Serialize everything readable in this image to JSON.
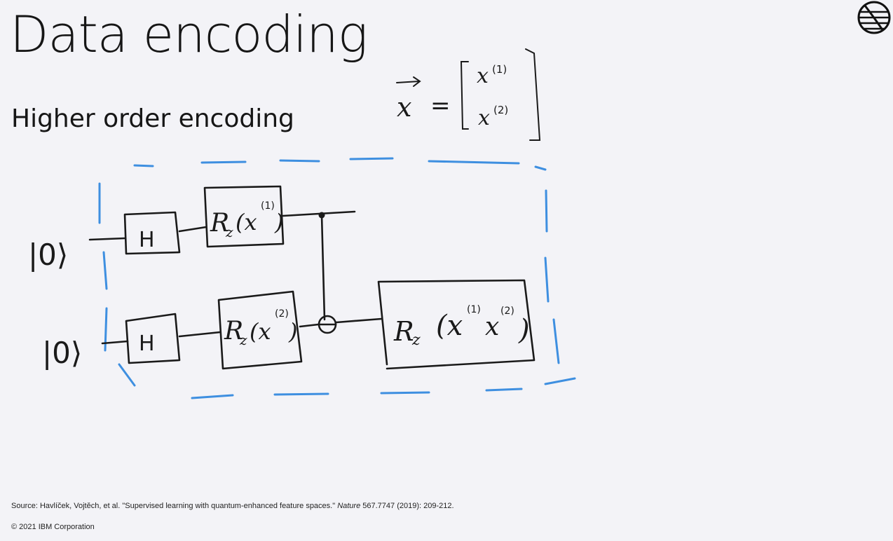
{
  "slide": {
    "title": "Data encoding",
    "subtitle": "Higher order encoding"
  },
  "vector": {
    "symbol": "x",
    "equals": "=",
    "entries": [
      "x",
      "x"
    ],
    "superscripts": [
      "(1)",
      "(2)"
    ]
  },
  "circuit": {
    "qubits": [
      {
        "state": "|0⟩",
        "hadamard": "H",
        "rz_gate": "R",
        "rz_sub": "z",
        "rz_arg": "(x",
        "rz_sup": "(1)",
        "rz_close": ")"
      },
      {
        "state": "|0⟩",
        "hadamard": "H",
        "rz_gate": "R",
        "rz_sub": "z",
        "rz_arg": "(x",
        "rz_sup": "(2)",
        "rz_close": ")"
      }
    ],
    "entangling_gate": {
      "r": "R",
      "sub": "z",
      "open": "(x",
      "sup1": "(1)",
      "x2": "x",
      "sup2": "(2)",
      "close": ")"
    }
  },
  "footer": {
    "source_prefix": "Source: Havlíček, Vojtěch, et al. \"Supervised learning with quantum-enhanced feature spaces.\" ",
    "source_journal": "Nature",
    "source_suffix": " 567.7747 (2019): 209-212.",
    "copyright": "© 2021 IBM Corporation"
  },
  "colors": {
    "background": "#f3f3f7",
    "ink": "#1a1a1a",
    "annotation_blue": "#3e8fe0"
  }
}
